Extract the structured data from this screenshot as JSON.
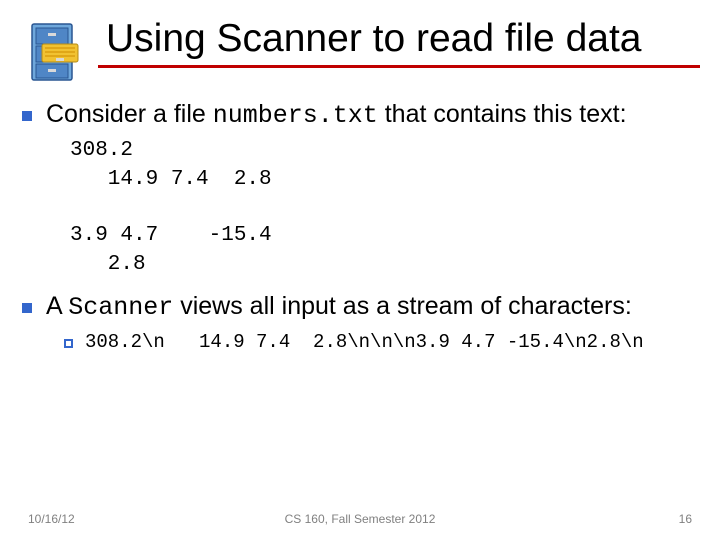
{
  "title": "Using Scanner to read file data",
  "bullets": {
    "consider_pre": "Consider a file ",
    "consider_code": "numbers.txt",
    "consider_post": " that contains this text:",
    "file_contents": "308.2\n   14.9 7.4  2.8\n\n3.9 4.7    -15.4\n   2.8",
    "scanner_pre": "A ",
    "scanner_code": "Scanner",
    "scanner_post": " views all input as a stream of characters:",
    "stream": "308.2\\n   14.9 7.4  2.8\\n\\n\\n3.9 4.7 -15.4\\n2.8\\n"
  },
  "footer": {
    "date": "10/16/12",
    "center": "CS 160, Fall Semester 2012",
    "page": "16"
  },
  "icon": "file-cabinet-icon"
}
